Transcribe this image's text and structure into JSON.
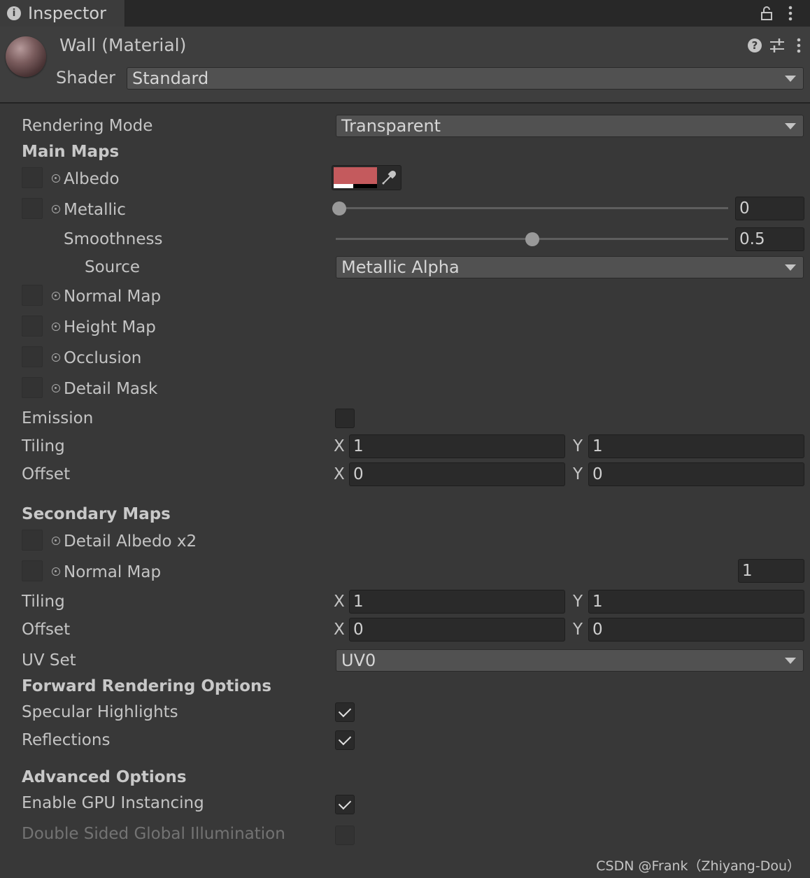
{
  "window": {
    "tab_title": "Inspector"
  },
  "header": {
    "material_name": "Wall (Material)",
    "shader_label": "Shader",
    "shader_value": "Standard"
  },
  "rendering_mode": {
    "label": "Rendering Mode",
    "value": "Transparent"
  },
  "main_maps": {
    "title": "Main Maps",
    "albedo": {
      "label": "Albedo",
      "color": "#c45a5d",
      "alpha_fraction": 0.45
    },
    "metallic": {
      "label": "Metallic",
      "value": "0",
      "slider_fraction": 0.0
    },
    "smoothness": {
      "label": "Smoothness",
      "value": "0.5",
      "slider_fraction": 0.5
    },
    "source": {
      "label": "Source",
      "value": "Metallic Alpha"
    },
    "normal_map": {
      "label": "Normal Map"
    },
    "height_map": {
      "label": "Height Map"
    },
    "occlusion": {
      "label": "Occlusion"
    },
    "detail_mask": {
      "label": "Detail Mask"
    },
    "emission": {
      "label": "Emission",
      "checked": false
    },
    "tiling": {
      "label": "Tiling",
      "x_label": "X",
      "x": "1",
      "y_label": "Y",
      "y": "1"
    },
    "offset": {
      "label": "Offset",
      "x_label": "X",
      "x": "0",
      "y_label": "Y",
      "y": "0"
    }
  },
  "secondary_maps": {
    "title": "Secondary Maps",
    "detail_albedo": {
      "label": "Detail Albedo x2"
    },
    "normal_map": {
      "label": "Normal Map",
      "value": "1"
    },
    "tiling": {
      "label": "Tiling",
      "x_label": "X",
      "x": "1",
      "y_label": "Y",
      "y": "1"
    },
    "offset": {
      "label": "Offset",
      "x_label": "X",
      "x": "0",
      "y_label": "Y",
      "y": "0"
    },
    "uv_set": {
      "label": "UV Set",
      "value": "UV0"
    }
  },
  "forward_rendering": {
    "title": "Forward Rendering Options",
    "specular_highlights": {
      "label": "Specular Highlights",
      "checked": true
    },
    "reflections": {
      "label": "Reflections",
      "checked": true
    }
  },
  "advanced": {
    "title": "Advanced Options",
    "gpu_instancing": {
      "label": "Enable GPU Instancing",
      "checked": true
    },
    "double_sided_gi": {
      "label": "Double Sided Global Illumination",
      "checked": false
    }
  },
  "watermark": "CSDN @Frank（Zhiyang-Dou）",
  "colors": {
    "background": "#383838",
    "tab_bar": "#282828",
    "field": "#2a2a2a",
    "dropdown": "#515151"
  },
  "icons": [
    "info-icon",
    "lock-icon",
    "kebab-menu-icon",
    "help-icon",
    "preset-sliders-icon",
    "object-picker-icon",
    "eyedropper-icon",
    "dropdown-arrow-icon",
    "checkmark-icon"
  ]
}
